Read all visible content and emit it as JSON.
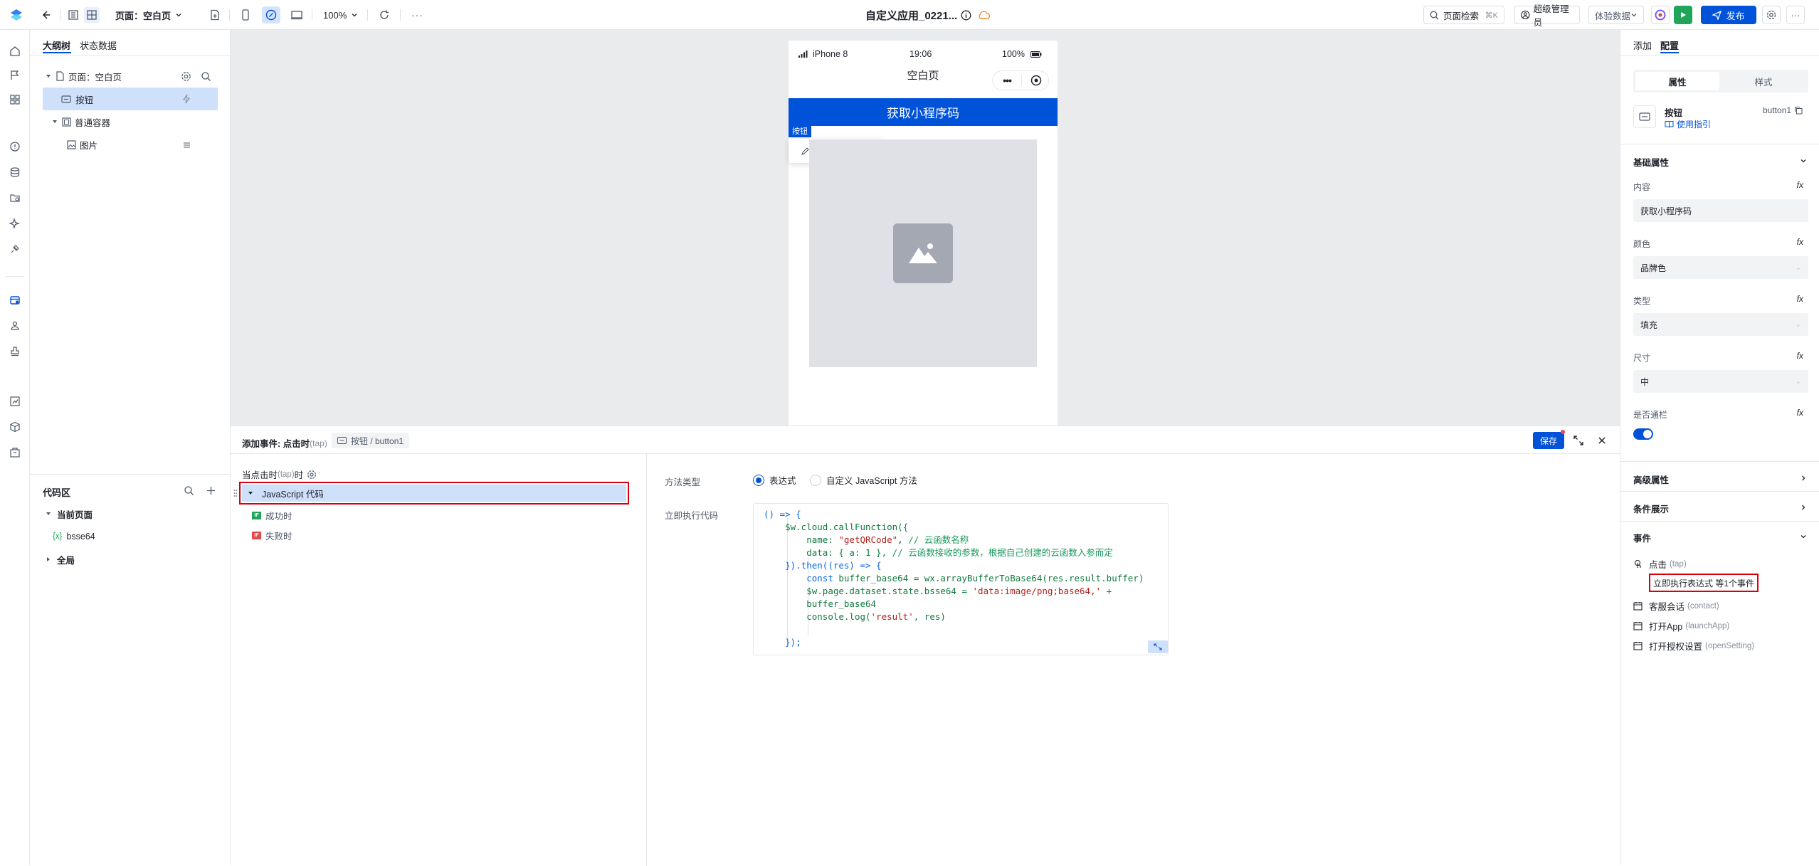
{
  "topbar": {
    "page_selector": "页面：空白页",
    "zoom": "100%",
    "app_title": "自定义应用_0221...",
    "search_label": "页面检索",
    "search_shortcut": "⌘K",
    "admin_label": "超级管理员",
    "data_mode": "体验数据",
    "publish_label": "发布",
    "more_label": "···"
  },
  "outline": {
    "tabs": [
      "大纲树",
      "状态数据"
    ],
    "tree": [
      {
        "label": "页面：空白页"
      },
      {
        "label": "按钮"
      },
      {
        "label": "普通容器"
      },
      {
        "label": "图片"
      }
    ]
  },
  "codearea": {
    "title": "代码区",
    "current_page": "当前页面",
    "var_name": "bsse64",
    "global": "全局"
  },
  "phone": {
    "carrier": "iPhone 8",
    "time": "19:06",
    "battery": "100%",
    "nav_title": "空白页",
    "button_text": "获取小程序码",
    "selected_tag": "按钮"
  },
  "events": {
    "title": "添加事件: 点击时",
    "title_tap": "(tap)",
    "breadcrumb": "按钮 / button1",
    "save_label": "保存",
    "trigger_prefix": "当点击时",
    "trigger_tap": "(tap)",
    "trigger_suffix": "时",
    "action_label": "JavaScript 代码",
    "success_label": "成功时",
    "fail_label": "失败时",
    "success_badge": "IF",
    "fail_badge": "IF",
    "method_type_label": "方法类型",
    "radio_expr": "表达式",
    "radio_custom": "自定义 JavaScript 方法",
    "exec_code_label": "立即执行代码"
  },
  "right": {
    "tabs": [
      "添加",
      "配置"
    ],
    "subtabs": [
      "属性",
      "样式"
    ],
    "component_name": "按钮",
    "component_id": "button1",
    "guide_label": "使用指引",
    "basic_props": "基础属性",
    "content_label": "内容",
    "content_value": "获取小程序码",
    "color_label": "颜色",
    "color_value": "品牌色",
    "type_label": "类型",
    "type_value": "填充",
    "size_label": "尺寸",
    "size_value": "中",
    "block_label": "是否通栏",
    "fx": "fx",
    "advanced_props": "高级属性",
    "condition_display": "条件展示",
    "events_section": "事件",
    "event_click": "点击",
    "event_click_tap": "(tap)",
    "event_click_desc": "立即执行表达式 等1个事件",
    "event_contact": "客服会话",
    "event_contact_key": "(contact)",
    "event_launch": "打开App",
    "event_launch_key": "(launchApp)",
    "event_setting": "打开授权设置",
    "event_setting_key": "(openSetting)"
  },
  "colors": {
    "brand": "#0052d9",
    "highlight": "#cfe0fb",
    "annotation_red": "#d8000c",
    "success_green": "#20a55a",
    "fail_red": "#e5484d"
  }
}
